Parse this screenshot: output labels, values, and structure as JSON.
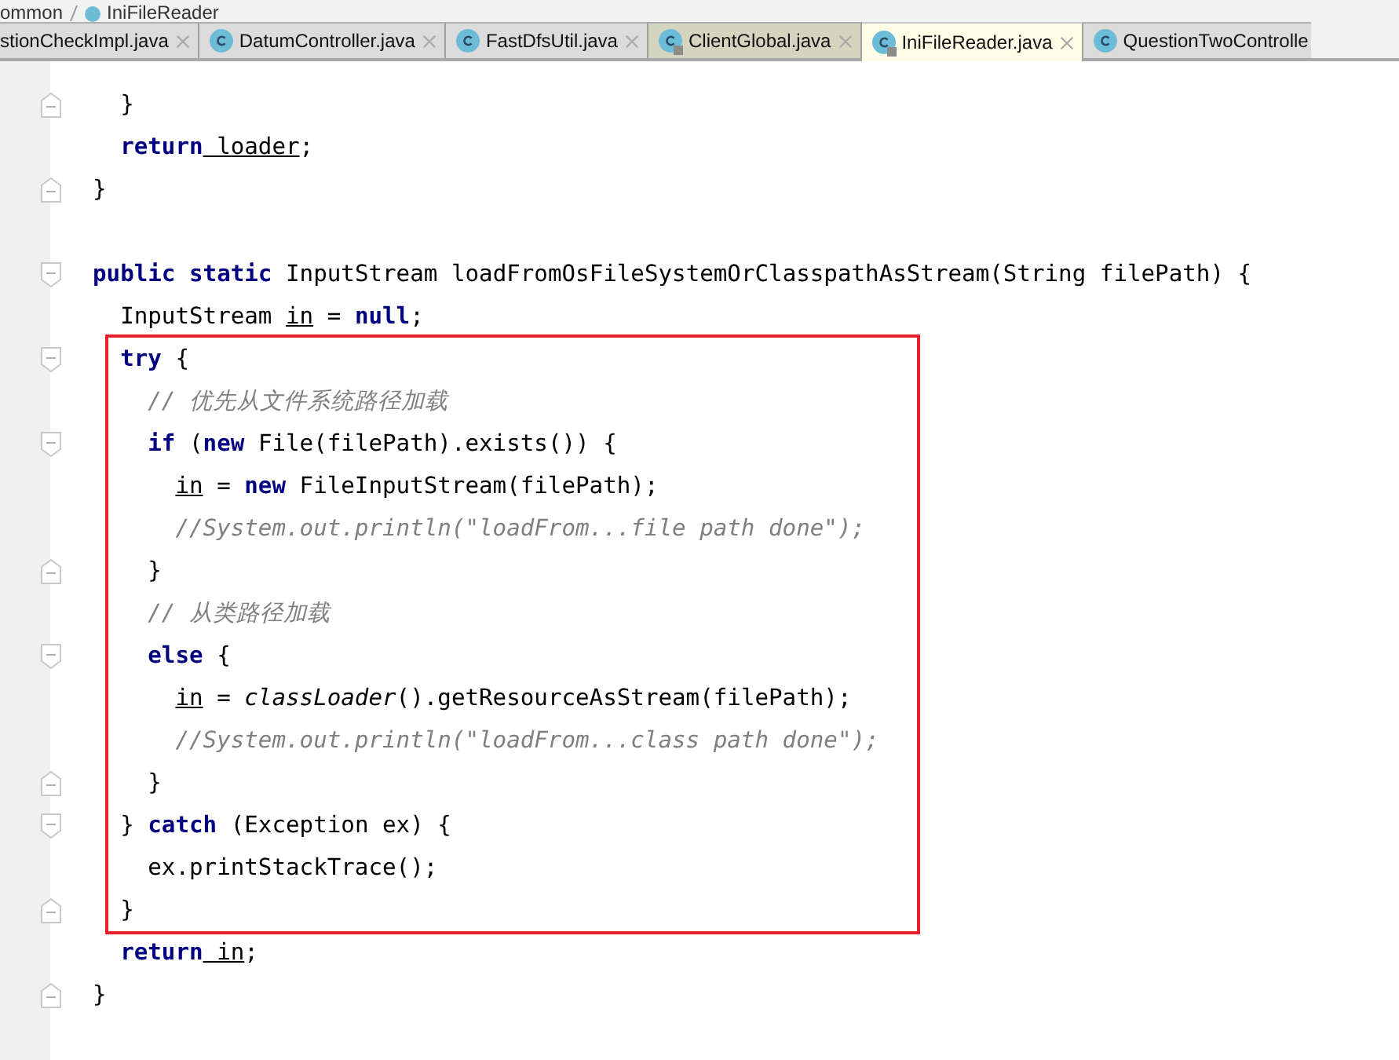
{
  "breadcrumb": [
    {
      "label": "ommon",
      "kind": "folder"
    },
    {
      "label": "IniFileReader",
      "kind": "class"
    }
  ],
  "tabs": [
    {
      "label": "stionCheckImpl.java",
      "selected": false,
      "icon": false,
      "locked": false,
      "closable": true,
      "color": "#dcdcdc"
    },
    {
      "label": "DatumController.java",
      "selected": false,
      "icon": true,
      "locked": false,
      "closable": true,
      "color": "#dcdcdc"
    },
    {
      "label": "FastDfsUtil.java",
      "selected": false,
      "icon": true,
      "locked": false,
      "closable": true,
      "color": "#dcdcdc"
    },
    {
      "label": "ClientGlobal.java",
      "selected": false,
      "icon": true,
      "locked": true,
      "closable": true,
      "color": "#d5d4bf"
    },
    {
      "label": "IniFileReader.java",
      "selected": true,
      "icon": true,
      "locked": true,
      "closable": true,
      "color": "#fffde6"
    },
    {
      "label": "QuestionTwoControlle",
      "selected": false,
      "icon": true,
      "locked": false,
      "closable": false,
      "color": "#dcdcdc"
    }
  ],
  "code": [
    {
      "kind": "scope",
      "children": [
        {
          "kind": "scope",
          "children": [
            {
              "kind": "blank"
            }
          ]
        },
        {
          "kind": "line",
          "fold_marker": true,
          "tokens": [
            {
              "kind": "plain",
              "t": "}"
            }
          ]
        },
        {
          "kind": "line",
          "fold_marker": false,
          "tokens": [
            {
              "kind": "kw",
              "t": "return"
            },
            {
              "kind": "var",
              "t": " loader"
            },
            {
              "kind": "plain",
              "t": ";"
            }
          ]
        }
      ]
    },
    {
      "kind": "line",
      "fold_marker": true,
      "tokens": [
        {
          "kind": "plain",
          "t": "}"
        }
      ]
    },
    {
      "kind": "blank"
    },
    {
      "kind": "line",
      "fold_marker": true,
      "tokens": [
        {
          "kind": "kw",
          "t": "public static"
        },
        {
          "kind": "plain",
          "t": " InputStream loadFromOsFileSystemOrClasspathAsStream(String filePath) {"
        }
      ],
      "children": [
        {
          "kind": "line",
          "fold_marker": false,
          "tokens": [
            {
              "kind": "plain",
              "t": "InputStream "
            },
            {
              "kind": "var",
              "t": "in"
            },
            {
              "kind": "plain",
              "t": " = "
            },
            {
              "kind": "kw",
              "t": "null"
            },
            {
              "kind": "plain",
              "t": ";"
            }
          ]
        },
        {
          "kind": "group",
          "boxed": true,
          "children": [
            {
              "kind": "line",
              "fold_marker": true,
              "tokens": [
                {
                  "kind": "kw",
                  "t": "try"
                },
                {
                  "kind": "plain",
                  "t": " {"
                }
              ],
              "children": [
                {
                  "kind": "line",
                  "fold_marker": false,
                  "tokens": [
                    {
                      "kind": "comment",
                      "t": "// 优先从文件系统路径加载"
                    }
                  ]
                },
                {
                  "kind": "line",
                  "fold_marker": true,
                  "tokens": [
                    {
                      "kind": "kw",
                      "t": "if"
                    },
                    {
                      "kind": "plain",
                      "t": " ("
                    },
                    {
                      "kind": "kw",
                      "t": "new"
                    },
                    {
                      "kind": "plain",
                      "t": " File(filePath).exists()) {"
                    }
                  ],
                  "children": [
                    {
                      "kind": "line",
                      "fold_marker": false,
                      "tokens": [
                        {
                          "kind": "var",
                          "t": "in"
                        },
                        {
                          "kind": "plain",
                          "t": " = "
                        },
                        {
                          "kind": "kw",
                          "t": "new"
                        },
                        {
                          "kind": "plain",
                          "t": " FileInputStream(filePath);"
                        }
                      ]
                    },
                    {
                      "kind": "line",
                      "fold_marker": false,
                      "tokens": [
                        {
                          "kind": "comment",
                          "t": "//System.out.println(\"loadFrom...file path done\");"
                        }
                      ]
                    }
                  ]
                },
                {
                  "kind": "line",
                  "fold_marker": true,
                  "tokens": [
                    {
                      "kind": "plain",
                      "t": "}"
                    }
                  ]
                },
                {
                  "kind": "line",
                  "fold_marker": false,
                  "tokens": [
                    {
                      "kind": "comment",
                      "t": "// 从类路径加载"
                    }
                  ]
                },
                {
                  "kind": "line",
                  "fold_marker": true,
                  "tokens": [
                    {
                      "kind": "kw",
                      "t": "else"
                    },
                    {
                      "kind": "plain",
                      "t": " {"
                    }
                  ],
                  "children": [
                    {
                      "kind": "line",
                      "fold_marker": false,
                      "tokens": [
                        {
                          "kind": "var",
                          "t": "in"
                        },
                        {
                          "kind": "plain",
                          "t": " = "
                        },
                        {
                          "kind": "static",
                          "t": "classLoader"
                        },
                        {
                          "kind": "plain",
                          "t": "().getResourceAsStream(filePath);"
                        }
                      ]
                    },
                    {
                      "kind": "line",
                      "fold_marker": false,
                      "tokens": [
                        {
                          "kind": "comment",
                          "t": "//System.out.println(\"loadFrom...class path done\");"
                        }
                      ]
                    }
                  ]
                },
                {
                  "kind": "line",
                  "fold_marker": true,
                  "tokens": [
                    {
                      "kind": "plain",
                      "t": "}"
                    }
                  ]
                }
              ]
            },
            {
              "kind": "line",
              "fold_marker": true,
              "tokens": [
                {
                  "kind": "plain",
                  "t": "} "
                },
                {
                  "kind": "kw",
                  "t": "catch"
                },
                {
                  "kind": "plain",
                  "t": " (Exception ex) {"
                }
              ],
              "children": [
                {
                  "kind": "line",
                  "fold_marker": false,
                  "tokens": [
                    {
                      "kind": "plain",
                      "t": "ex.printStackTrace();"
                    }
                  ]
                }
              ]
            },
            {
              "kind": "line",
              "fold_marker": true,
              "tokens": [
                {
                  "kind": "plain",
                  "t": "}"
                }
              ]
            }
          ]
        },
        {
          "kind": "line",
          "fold_marker": false,
          "tokens": [
            {
              "kind": "kw",
              "t": "return"
            },
            {
              "kind": "var",
              "t": " in"
            },
            {
              "kind": "plain",
              "t": ";"
            }
          ]
        }
      ]
    },
    {
      "kind": "line",
      "fold_marker": true,
      "tokens": [
        {
          "kind": "plain",
          "t": "}"
        }
      ]
    }
  ]
}
